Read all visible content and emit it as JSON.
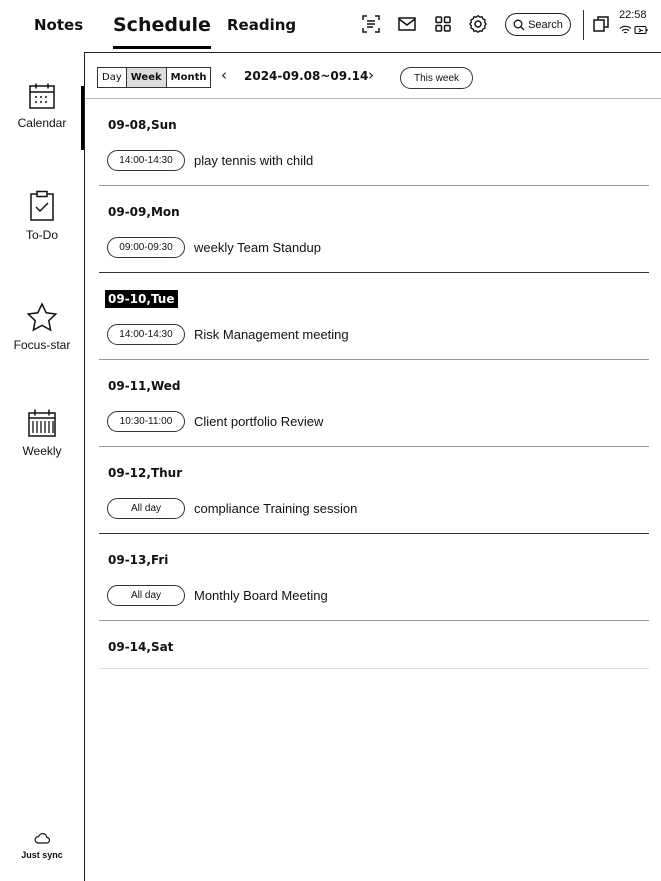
{
  "header": {
    "tabs": [
      {
        "label": "Notes"
      },
      {
        "label": "Schedule"
      },
      {
        "label": "Reading"
      }
    ],
    "search_label": "Search",
    "clock": "22:58",
    "icons": [
      "scan-icon",
      "mail-icon",
      "apps-icon",
      "settings-icon",
      "window-icon",
      "wifi-icon",
      "battery-icon"
    ]
  },
  "sidebar": {
    "items": [
      {
        "label": "Calendar",
        "icon": "calendar-icon"
      },
      {
        "label": "To-Do",
        "icon": "todo-icon"
      },
      {
        "label": "Focus-star",
        "icon": "star-icon"
      },
      {
        "label": "Weekly",
        "icon": "weekly-icon"
      }
    ],
    "sync_label": "Just sync"
  },
  "toolbar": {
    "views": [
      "Day",
      "Week",
      "Month"
    ],
    "selected_view": "Week",
    "range": "2024-09.08~09.14",
    "this_week": "This week"
  },
  "days": [
    {
      "label": "09-08,Sun",
      "event": {
        "time": "14:00-14:30",
        "title": "play tennis with child"
      }
    },
    {
      "label": "09-09,Mon",
      "event": {
        "time": "09:00-09:30",
        "title": "weekly Team Standup"
      }
    },
    {
      "label": "09-10,Tue",
      "event": {
        "time": "14:00-14:30",
        "title": "Risk Management meeting"
      }
    },
    {
      "label": "09-11,Wed",
      "event": {
        "time": "10:30-11:00",
        "title": "Client portfolio Review"
      }
    },
    {
      "label": "09-12,Thur",
      "event": {
        "time": "All day",
        "title": "compliance Training session"
      }
    },
    {
      "label": "09-13,Fri",
      "event": {
        "time": "All day",
        "title": "Monthly Board Meeting"
      }
    },
    {
      "label": "09-14,Sat"
    }
  ],
  "colors": {
    "ink": "#111111",
    "selected_bg": "#dddddd",
    "highlight": "#000000"
  }
}
